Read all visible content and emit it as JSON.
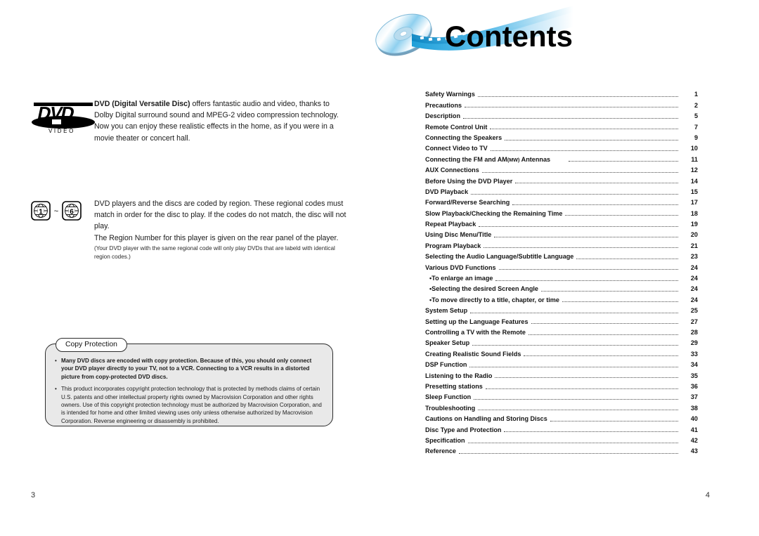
{
  "header": {
    "title": "Contents",
    "logo_icon": "dvd-disc-filmstrip-icon",
    "accent_color": "#29a8e0",
    "title_color": "#000000"
  },
  "left_page": {
    "dvd_section": {
      "logo_icon": "dvd-video-logo",
      "logo_primary_text": "DVD",
      "logo_secondary_text": "V I D E O",
      "lead_bold": "DVD (Digital Versatile Disc)",
      "body": " offers fantastic audio and video, thanks to Dolby Digital surround sound and MPEG-2 video compression technology. Now you can enjoy these realistic effects in the home, as if you were in a movie theater or concert hall."
    },
    "region_section": {
      "icon_left_label": "1",
      "icon_right_label": "6",
      "icon_separator": "~",
      "icon_name": "region-code-globe-icon",
      "paragraph1": "DVD players and the discs are coded by region. These regional codes must match in order for the disc to play. If the codes do not match, the disc will not play.",
      "paragraph2": "The Region Number for this player is given on the rear panel of the player.",
      "note": "(Your DVD player with the same regional code will only play DVDs that are labeld with identical region codes.)"
    },
    "copy_protection": {
      "tab_label": "Copy Protection",
      "box_fill": "#e9e9e9",
      "box_border": "#2b2b2b",
      "bullets": [
        {
          "bullet": "•",
          "bold": true,
          "text": "Many DVD discs are encoded with copy protection. Because of this, you should only connect your DVD player directly to your TV, not to a VCR. Connecting to a VCR results in a distorted picture from copy-protected DVD discs."
        },
        {
          "bullet": "•",
          "bold": false,
          "text": "This product incorporates copyright protection technology that is protected by methods claims of certain U.S. patents and other intellectual property rights owned by Macrovision Corporation and other rights owners. Use of this copyright protection technology must be authorized by Macrovision Corporation, and is intended for home and other limited viewing uses only unless otherwise authorized by Macrovision Corporation. Reverse engineering or disassembly is prohibited."
        }
      ]
    },
    "folio": "3"
  },
  "right_page": {
    "toc": [
      {
        "label": "Safety Warnings",
        "page": "1",
        "sub": false
      },
      {
        "label": "Precautions",
        "page": "2",
        "sub": false
      },
      {
        "label": "Description",
        "page": "5",
        "sub": false
      },
      {
        "label": "Remote Control Unit",
        "page": "7",
        "sub": false
      },
      {
        "label": "Connecting the Speakers",
        "page": "9",
        "sub": false
      },
      {
        "label": "Connect Video to TV",
        "page": "10",
        "sub": false
      },
      {
        "label": "Connecting the FM and AM",
        "small_caps": "(MW)",
        "label_tail": " Antennas",
        "page": "11",
        "sub": false,
        "wide_gap": true
      },
      {
        "label": "AUX Connections",
        "page": "12",
        "sub": false
      },
      {
        "label": "Before Using the DVD Player",
        "page": "14",
        "sub": false
      },
      {
        "label": "DVD Playback",
        "page": "15",
        "sub": false
      },
      {
        "label": "Forward/Reverse Searching",
        "page": "17",
        "sub": false
      },
      {
        "label": "Slow Playback/Checking the Remaining Time",
        "page": "18",
        "sub": false
      },
      {
        "label": "Repeat Playback",
        "page": "19",
        "sub": false
      },
      {
        "label": "Using Disc Menu/Title",
        "page": "20",
        "sub": false
      },
      {
        "label": "Program Playback",
        "page": "21",
        "sub": false
      },
      {
        "label": "Selecting the Audio Language/Subtitle Language",
        "page": "23",
        "sub": false
      },
      {
        "label": "Various DVD Functions",
        "page": "24",
        "sub": false
      },
      {
        "label": "•To enlarge an image",
        "page": "24",
        "sub": true
      },
      {
        "label": "•Selecting the desired Screen Angle",
        "page": "24",
        "sub": true
      },
      {
        "label": "•To move directly to a title, chapter, or time",
        "page": "24",
        "sub": true
      },
      {
        "label": "System Setup",
        "page": "25",
        "sub": false
      },
      {
        "label": "Setting up the Language Features",
        "page": "27",
        "sub": false
      },
      {
        "label": "Controlling a TV with the Remote",
        "page": "28",
        "sub": false
      },
      {
        "label": "Speaker Setup",
        "page": "29",
        "sub": false
      },
      {
        "label": "Creating Realistic Sound Fields",
        "page": "33",
        "sub": false
      },
      {
        "label": "DSP Function",
        "page": "34",
        "sub": false
      },
      {
        "label": "Listening to the Radio",
        "page": "35",
        "sub": false
      },
      {
        "label": "Presetting stations",
        "page": "36",
        "sub": false
      },
      {
        "label": "Sleep Function",
        "page": "37",
        "sub": false
      },
      {
        "label": "Troubleshooting",
        "page": "38",
        "sub": false
      },
      {
        "label": "Cautions on Handling and Storing Discs",
        "page": "40",
        "sub": false
      },
      {
        "label": "Disc Type and Protection",
        "page": "41",
        "sub": false
      },
      {
        "label": "Specification",
        "page": "42",
        "sub": false
      },
      {
        "label": "Reference",
        "page": "43",
        "sub": false
      }
    ],
    "folio": "4"
  }
}
